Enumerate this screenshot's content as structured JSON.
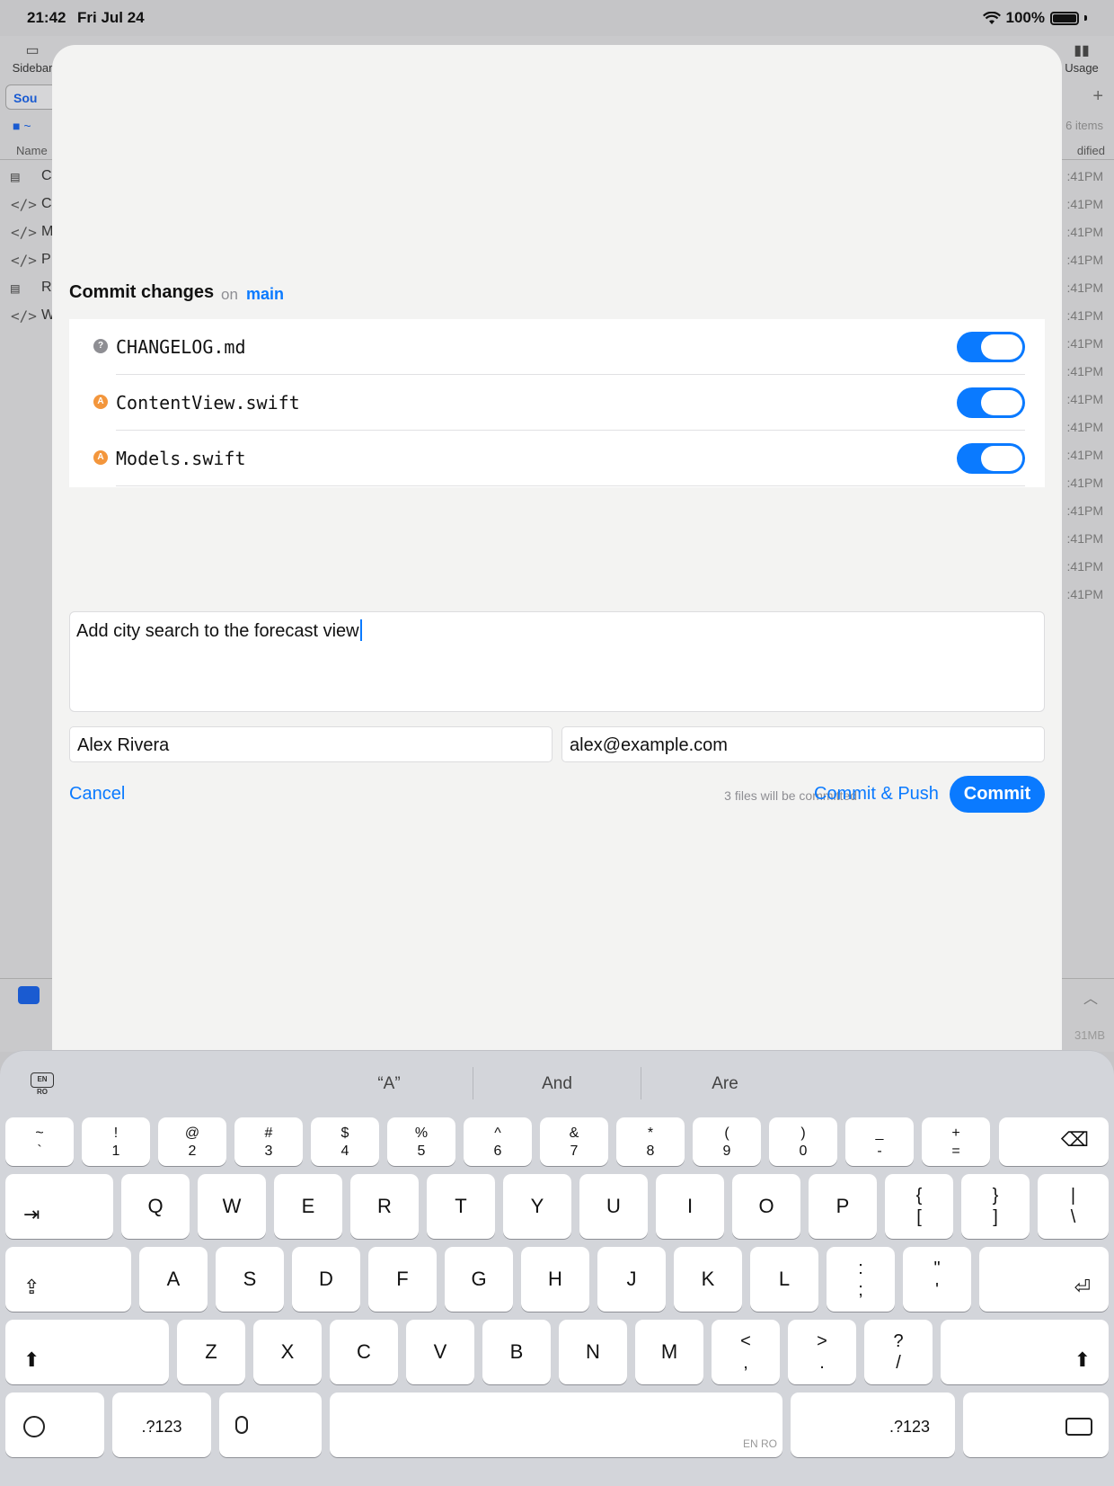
{
  "status_bar": {
    "time": "21:42",
    "date": "Fri Jul 24",
    "battery": "100%"
  },
  "background_app": {
    "sidebar_label": "Sidebar",
    "usage_label": "Usage",
    "tab_label": "Sou",
    "path_label": "~",
    "items_label": "6 items",
    "name_header": "Name",
    "modified_header": "dified",
    "rows": [
      {
        "icon": "▤",
        "letter": "C"
      },
      {
        "icon": "</>",
        "letter": "C"
      },
      {
        "icon": "</>",
        "letter": "M"
      },
      {
        "icon": "</>",
        "letter": "P"
      },
      {
        "icon": "▤",
        "letter": "R"
      },
      {
        "icon": "</>",
        "letter": "W"
      }
    ],
    "times": [
      ":41PM",
      ":41PM",
      ":41PM",
      ":41PM",
      ":41PM",
      ":41PM",
      ":41PM",
      ":41PM",
      ":41PM",
      ":41PM",
      ":41PM",
      ":41PM",
      ":41PM",
      ":41PM",
      ":41PM",
      ":41PM"
    ],
    "bottom_path": "~",
    "bottom_size": "31MB"
  },
  "commit_sheet": {
    "title": "Commit changes",
    "on_label": "on",
    "branch": "main",
    "files": [
      {
        "name": "CHANGELOG.md",
        "status": "?",
        "enabled": true
      },
      {
        "name": "ContentView.swift",
        "status": "A",
        "enabled": true
      },
      {
        "name": "Models.swift",
        "status": "A",
        "enabled": true
      }
    ],
    "message": "Add city search to the forecast view",
    "author_name": "Alex Rivera",
    "author_email": "alex@example.com",
    "cancel_label": "Cancel",
    "files_count_text": "3 files will be committed",
    "commit_push_label": "Commit & Push",
    "commit_label": "Commit"
  },
  "keyboard": {
    "lang_badge": "EN RO",
    "suggestions": [
      "“A”",
      "And",
      "Are"
    ],
    "number_row": [
      {
        "top": "~",
        "bottom": "`"
      },
      {
        "top": "!",
        "bottom": "1"
      },
      {
        "top": "@",
        "bottom": "2"
      },
      {
        "top": "#",
        "bottom": "3"
      },
      {
        "top": "$",
        "bottom": "4"
      },
      {
        "top": "%",
        "bottom": "5"
      },
      {
        "top": "^",
        "bottom": "6"
      },
      {
        "top": "&",
        "bottom": "7"
      },
      {
        "top": "*",
        "bottom": "8"
      },
      {
        "top": "(",
        "bottom": "9"
      },
      {
        "top": ")",
        "bottom": "0"
      },
      {
        "top": "_",
        "bottom": "-"
      },
      {
        "top": "+",
        "bottom": "="
      }
    ],
    "row_q": [
      "Q",
      "W",
      "E",
      "R",
      "T",
      "Y",
      "U",
      "I",
      "O",
      "P"
    ],
    "row_q_symbols": [
      {
        "top": "{",
        "bottom": "["
      },
      {
        "top": "}",
        "bottom": "]"
      },
      {
        "top": "|",
        "bottom": "\\"
      }
    ],
    "row_a": [
      "A",
      "S",
      "D",
      "F",
      "G",
      "H",
      "J",
      "K",
      "L"
    ],
    "row_a_symbols": [
      {
        "top": ":",
        "bottom": ";"
      },
      {
        "top": "\"",
        "bottom": "'"
      }
    ],
    "row_z": [
      "Z",
      "X",
      "C",
      "V",
      "B",
      "N",
      "M"
    ],
    "row_z_symbols": [
      {
        "top": "<",
        "bottom": ","
      },
      {
        "top": ">",
        "bottom": "."
      },
      {
        "top": "?",
        "bottom": "/"
      }
    ],
    "numbers_label": ".?123",
    "space_lang": "EN RO",
    "delete_glyph": "⌫",
    "tab_glyph": "⇥",
    "return_glyph": "⏎",
    "caps_glyph": "⇪",
    "shift_glyph": "⬆"
  }
}
